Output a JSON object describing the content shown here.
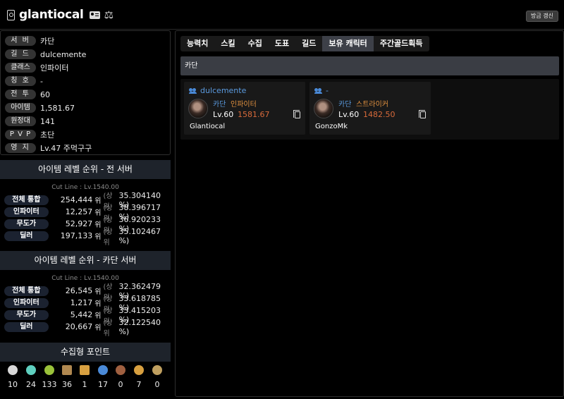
{
  "header": {
    "character_name": "glantiocal",
    "refresh_label": "방금 갱신"
  },
  "profile": {
    "rows": [
      {
        "label": "서 버",
        "value": "카단"
      },
      {
        "label": "길 드",
        "value": "dulcemente"
      },
      {
        "label": "클래스",
        "value": "인파이터"
      },
      {
        "label": "칭 호",
        "value": "-"
      },
      {
        "label": "전 투",
        "value": "60"
      },
      {
        "label": "아이템",
        "value": "1,581.67"
      },
      {
        "label": "원정대",
        "value": "141"
      },
      {
        "label": "P V P",
        "value": "초단"
      },
      {
        "label": "영 지",
        "value": "Lv.47 주먹구구"
      }
    ]
  },
  "rank_all": {
    "title": "아이템 레벨 순위 - 전 서버",
    "cutline": "Cut Line : Lv.1540.00",
    "rows": [
      {
        "label": "전체 통합",
        "rank": "254,444",
        "unit": "위",
        "top": "(상위",
        "pct": "35.304140 %)"
      },
      {
        "label": "인파이터",
        "rank": "12,257",
        "unit": "위",
        "top": "(상위",
        "pct": "38.396717 %)"
      },
      {
        "label": "무도가",
        "rank": "52,927",
        "unit": "위",
        "top": "(상위",
        "pct": "36.920233 %)"
      },
      {
        "label": "딜러",
        "rank": "197,133",
        "unit": "위",
        "top": "(상위",
        "pct": "35.102467 %)"
      }
    ]
  },
  "rank_server": {
    "title": "아이템 레벨 순위 - 카단 서버",
    "cutline": "Cut Line : Lv.1540.00",
    "rows": [
      {
        "label": "전체 통합",
        "rank": "26,545",
        "unit": "위",
        "top": "(상위",
        "pct": "32.362479 %)"
      },
      {
        "label": "인파이터",
        "rank": "1,217",
        "unit": "위",
        "top": "(상위",
        "pct": "33.618785 %)"
      },
      {
        "label": "무도가",
        "rank": "5,442",
        "unit": "위",
        "top": "(상위",
        "pct": "33.415203 %)"
      },
      {
        "label": "딜러",
        "rank": "20,667",
        "unit": "위",
        "top": "(상위",
        "pct": "32.122540 %)"
      }
    ]
  },
  "collection": {
    "title": "수집형 포인트",
    "items": [
      {
        "icon": "island-heart-icon",
        "count": "10",
        "color": "#d8d8d8"
      },
      {
        "icon": "orpheus-star-icon",
        "count": "24",
        "color": "#5fd0c0"
      },
      {
        "icon": "mokoko-seed-icon",
        "count": "133",
        "color": "#9ac23a"
      },
      {
        "icon": "great-artwork-icon",
        "count": "36",
        "color": "#b08850"
      },
      {
        "icon": "sea-bounty-icon",
        "count": "1",
        "color": "#d8a040"
      },
      {
        "icon": "world-tree-leaf-icon",
        "count": "17",
        "color": "#4a8ad8"
      },
      {
        "icon": "igneas-token-icon",
        "count": "0",
        "color": "#a06040"
      },
      {
        "icon": "giants-heart-icon",
        "count": "7",
        "color": "#d8a040"
      },
      {
        "icon": "masterpiece-icon",
        "count": "0",
        "color": "#c0a060"
      }
    ]
  },
  "tabs": [
    {
      "label": "능력치",
      "active": false
    },
    {
      "label": "스킬",
      "active": false
    },
    {
      "label": "수집",
      "active": false
    },
    {
      "label": "도표",
      "active": false
    },
    {
      "label": "길드",
      "active": false
    },
    {
      "label": "보유 캐릭터",
      "active": true
    },
    {
      "label": "주간골드획득",
      "active": false
    }
  ],
  "server_bar": "카단",
  "characters": [
    {
      "guild": "dulcemente",
      "server": "카단",
      "class": "인파이터",
      "level": "Lv.60",
      "item_level": "1581.67",
      "name": "Glantiocal"
    },
    {
      "guild": "-",
      "server": "카단",
      "class": "스트라이커",
      "level": "Lv.60",
      "item_level": "1482.50",
      "name": "GonzoMk"
    }
  ]
}
